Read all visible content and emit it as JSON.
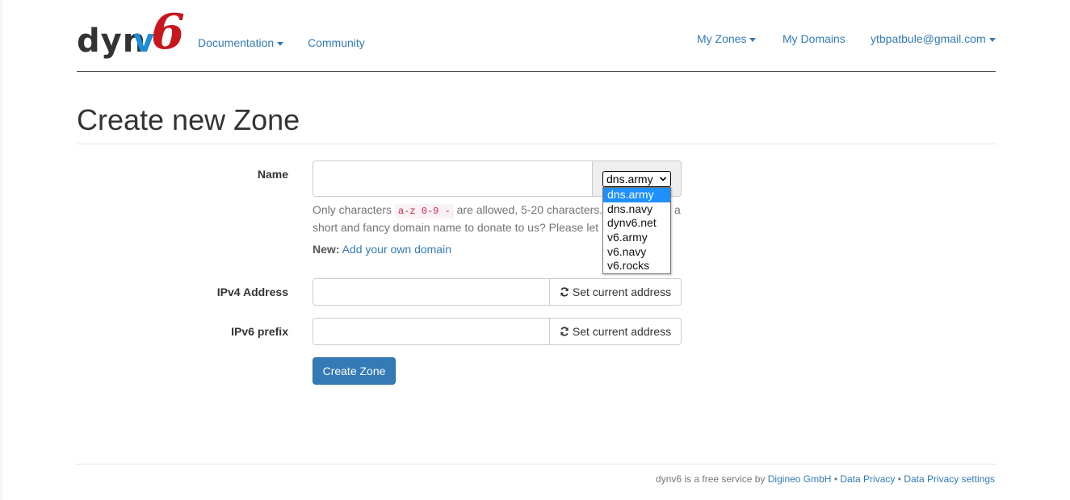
{
  "nav": {
    "logo": {
      "part1": "dyn",
      "part2": "v",
      "part3": "6"
    },
    "documentation": "Documentation",
    "community": "Community",
    "my_zones": "My Zones",
    "my_domains": "My Domains",
    "user": "ytbpatbule@gmail.com"
  },
  "page": {
    "title": "Create new Zone"
  },
  "form": {
    "name_label": "Name",
    "name_value": "",
    "domain_select": {
      "selected": "dns.army",
      "options": [
        "dns.army",
        "dns.navy",
        "dynv6.net",
        "v6.army",
        "v6.navy",
        "v6.rocks"
      ]
    },
    "help": {
      "prefix": "Only characters",
      "chars": "a-z 0-9 -",
      "suffix": "are allowed, 5-20 characters.",
      "line1_end": "a",
      "line2": "short and fancy domain name to donate to us? Please let"
    },
    "new_label": "New:",
    "new_link": "Add your own domain",
    "ipv4_label": "IPv4 Address",
    "ipv4_value": "",
    "ipv6_label": "IPv6 prefix",
    "ipv6_value": "",
    "set_current_address": "Set current address",
    "submit": "Create Zone"
  },
  "footer": {
    "text": "dynv6 is a free service by",
    "company": "Digineo GmbH",
    "sep": "•",
    "privacy": "Data Privacy",
    "privacy_settings": "Data Privacy settings"
  },
  "colors": {
    "link": "#337ab7",
    "primary": "#337ab7",
    "logo_blue": "#1a8fd8",
    "logo_red": "#c8161d",
    "option_selected": "#1e90ff"
  }
}
